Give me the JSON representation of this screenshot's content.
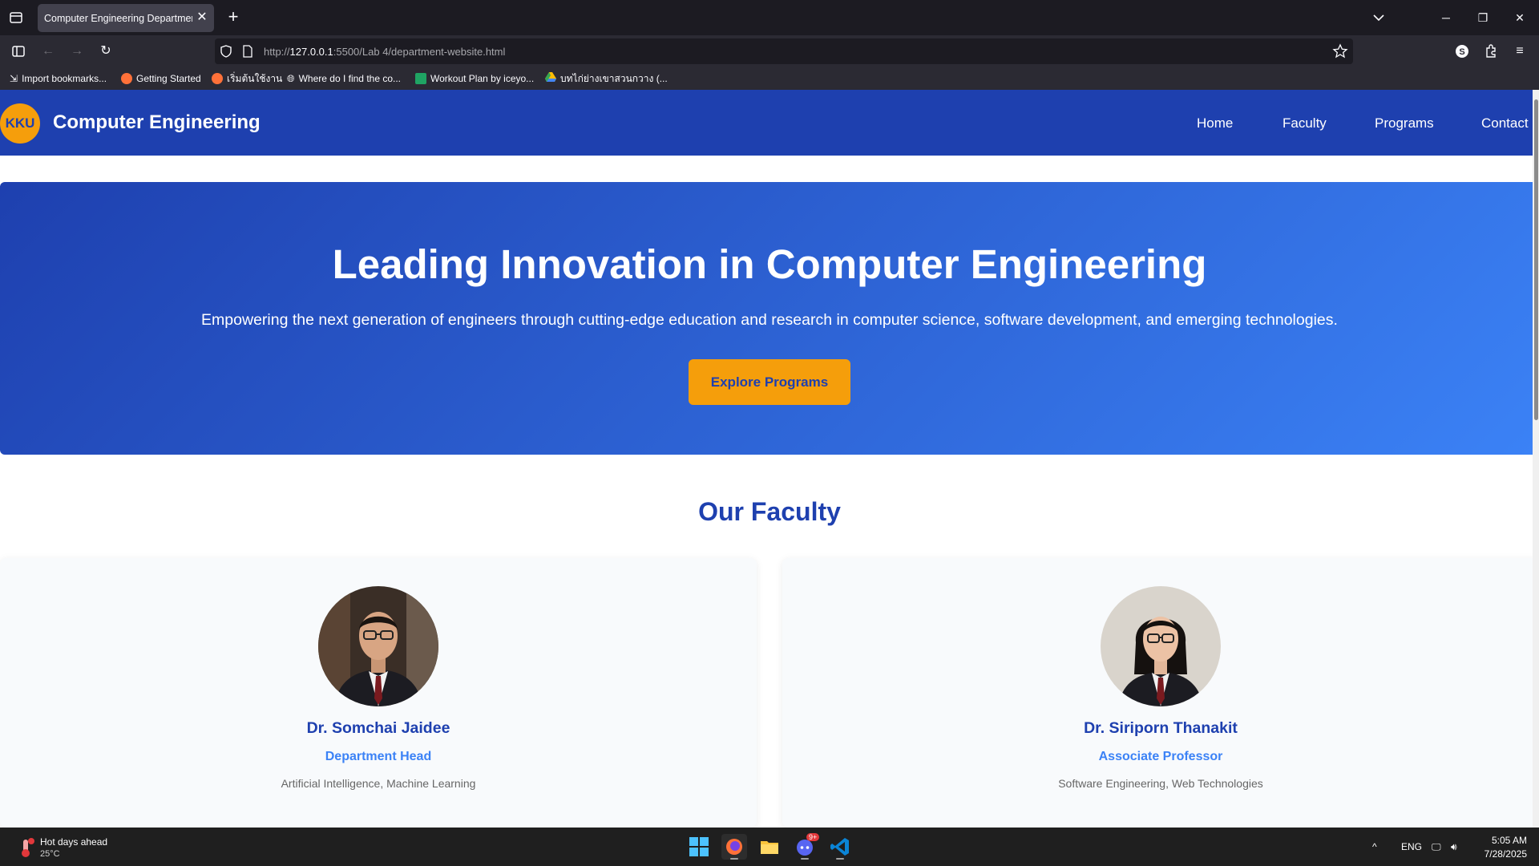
{
  "browser": {
    "tab_title": "Computer Engineering Department",
    "url_prefix": "http://",
    "url_host": "127.0.0.1",
    "url_rest": ":5500/Lab 4/department-website.html",
    "bookmarks": [
      "Import bookmarks...",
      "Getting Started",
      "เริ่มต้นใช้งาน",
      "Where do I find the co...",
      "Workout Plan by iceyo...",
      "บทไก่ย่างเขาสวนกวาง (..."
    ]
  },
  "site": {
    "logo": "KKU",
    "title": "Computer Engineering",
    "nav": [
      "Home",
      "Faculty",
      "Programs",
      "Contact"
    ],
    "hero_title": "Leading Innovation in Computer Engineering",
    "hero_subtitle": "Empowering the next generation of engineers through cutting-edge education and research in computer science, software development, and emerging technologies.",
    "hero_button": "Explore Programs",
    "faculty_heading": "Our Faculty",
    "faculty": [
      {
        "name": "Dr. Somchai Jaidee",
        "role": "Department Head",
        "specialty": "Artificial Intelligence, Machine Learning"
      },
      {
        "name": "Dr. Siriporn Thanakit",
        "role": "Associate Professor",
        "specialty": "Software Engineering, Web Technologies"
      }
    ]
  },
  "taskbar": {
    "weather_title": "Hot days ahead",
    "weather_temp": "25°C",
    "language": "ENG",
    "time": "5:05 AM",
    "date": "7/28/2025",
    "discord_badge": "9+"
  },
  "colors": {
    "primary": "#1e40af",
    "secondary": "#3b82f6",
    "accent": "#f59e0b"
  }
}
